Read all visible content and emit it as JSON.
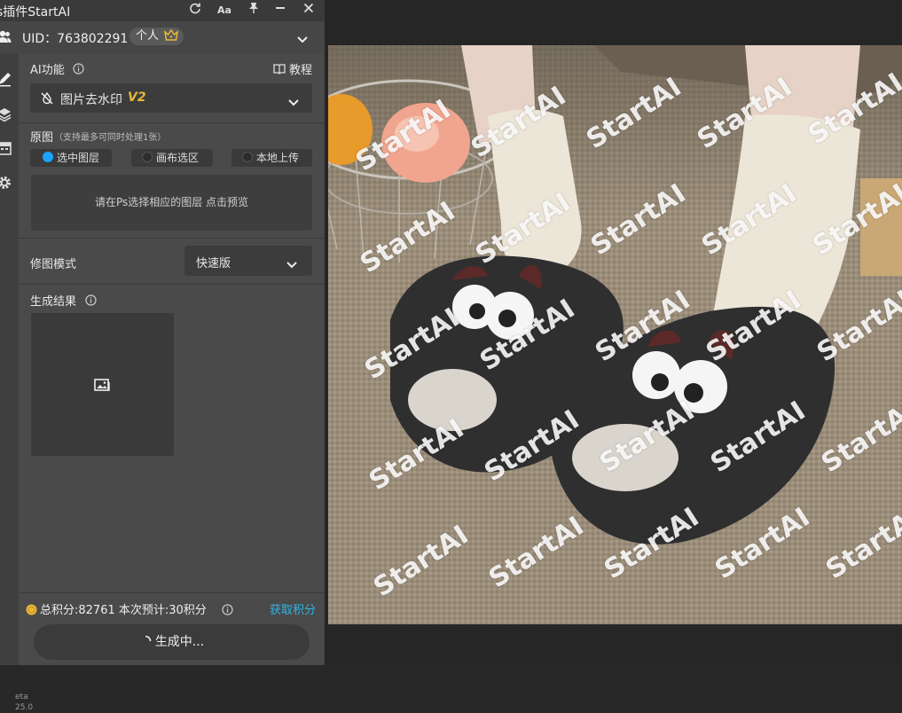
{
  "window": {
    "title": "s插件StartAI",
    "buttons": [
      "refresh-icon",
      "font-size-icon",
      "pin-icon",
      "minimize-icon",
      "close-icon"
    ]
  },
  "user": {
    "uid_label": "UID：763802291",
    "plan_badge": "个人",
    "expand_icon": "chevron-down-icon"
  },
  "sidebar": [
    "brush-icon",
    "layers-icon",
    "calendar-icon",
    "gear-icon"
  ],
  "ai_function": {
    "label": "AI功能",
    "tutorial_label": "教程",
    "selected": "图片去水印",
    "version_tag": "V2"
  },
  "source": {
    "label": "原图",
    "note": "（支持最多可同时处理1张）",
    "options": [
      "选中图层",
      "画布选区",
      "本地上传"
    ],
    "selected_index": 0,
    "preview_hint": "请在Ps选择相应的图层 点击预览"
  },
  "mode": {
    "label": "修图模式",
    "value": "快速版"
  },
  "result": {
    "label": "生成结果"
  },
  "footer": {
    "points": "总积分:82761  本次预计:30积分",
    "get_points": "获取积分",
    "generate_label": "生成中...",
    "version_line1": "eta",
    "version_line2": "25.0"
  },
  "watermark": {
    "text": "StartAI"
  },
  "colors": {
    "accent": "#1aa3ff",
    "link": "#2bb8e8",
    "gold": "#e8b83a"
  }
}
